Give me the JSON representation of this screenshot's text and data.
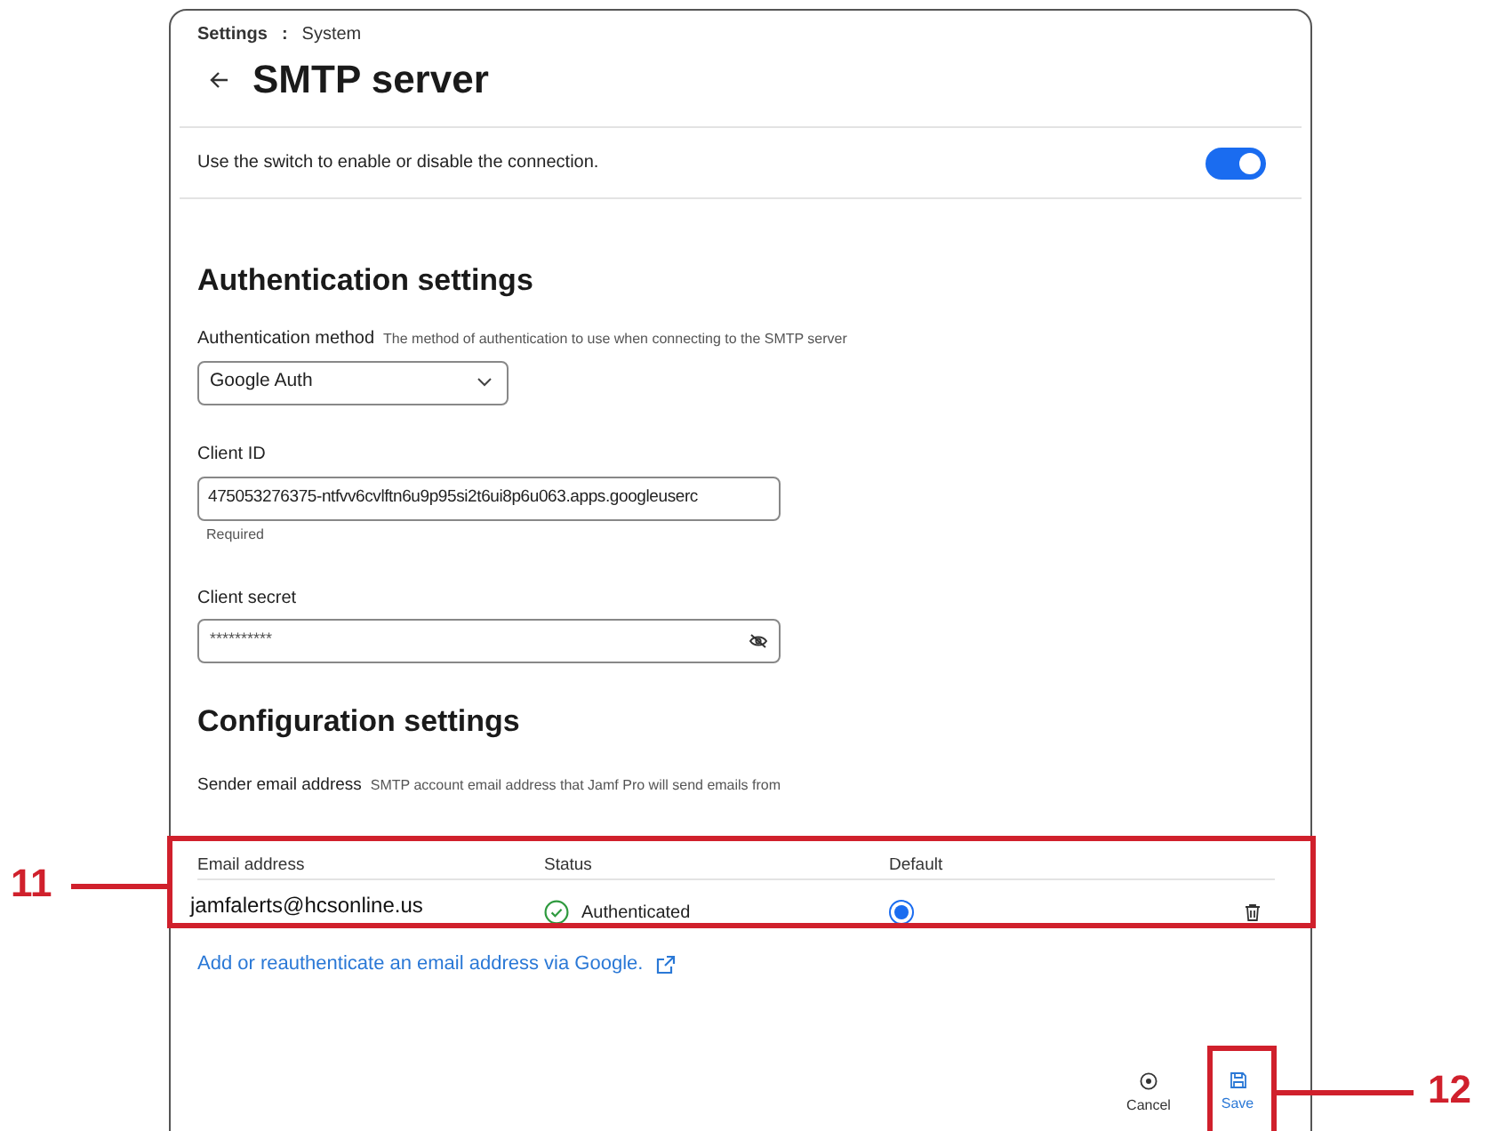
{
  "breadcrumb": {
    "parent": "Settings",
    "separator": ":",
    "current": "System"
  },
  "title": "SMTP server",
  "connection": {
    "text": "Use the switch to enable or disable the connection.",
    "on": true
  },
  "authentication": {
    "heading": "Authentication settings",
    "method": {
      "label": "Authentication method",
      "hint": "The method of authentication to use when connecting to the SMTP server",
      "value": "Google Auth"
    },
    "client_id": {
      "label": "Client ID",
      "value": "475053276375-ntfvv6cvlftn6u9p95si2t6ui8p6u063.apps.googleuserc",
      "helper": "Required"
    },
    "client_secret": {
      "label": "Client secret",
      "value": "**********"
    }
  },
  "configuration": {
    "heading": "Configuration settings",
    "sender_label": "Sender email address",
    "sender_hint": "SMTP account email address that Jamf Pro will send emails from",
    "columns": [
      "Email address",
      "Status",
      "Default"
    ],
    "rows": [
      {
        "email": "jamfalerts@hcsonline.us",
        "status": "Authenticated",
        "selected": true
      }
    ],
    "link": "Add or reauthenticate an email address via Google."
  },
  "footer": {
    "buttons": [
      {
        "kind": "cancel",
        "label": "Cancel"
      },
      {
        "kind": "save",
        "label": "Save"
      }
    ]
  },
  "annotations": [
    {
      "label": "11"
    },
    {
      "label": "12"
    }
  ]
}
